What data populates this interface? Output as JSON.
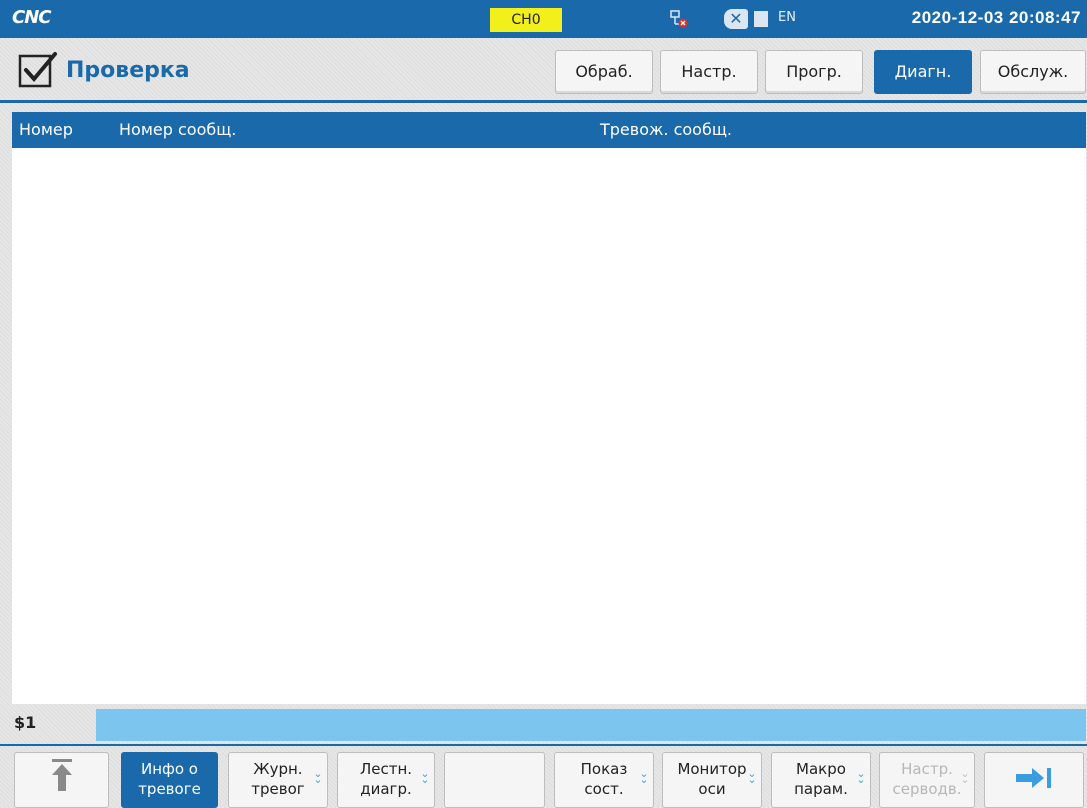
{
  "topbar": {
    "logo": "CNC",
    "channel": "CH0",
    "lang": "EN",
    "datetime": "2020-12-03 20:08:47",
    "colors": {
      "bar": "#1a6aab",
      "channel_bg": "#f2ef1b"
    }
  },
  "page": {
    "title": "Проверка"
  },
  "tabs": [
    {
      "label": "Обраб.",
      "active": false
    },
    {
      "label": "Настр.",
      "active": false
    },
    {
      "label": "Прогр.",
      "active": false
    },
    {
      "label": "Диагн.",
      "active": true
    },
    {
      "label": "Обслуж.",
      "active": false
    }
  ],
  "table": {
    "headers": [
      "Номер",
      "Номер сообщ.",
      "Тревож. сообщ."
    ],
    "rows": []
  },
  "status": {
    "prefix": "$1",
    "command": ""
  },
  "softkeys": [
    {
      "line1": "",
      "line2": "",
      "icon": "arrow-up-top-icon",
      "active": false,
      "disabled": false,
      "menu": false
    },
    {
      "line1": "Инфо о",
      "line2": "тревоге",
      "active": true,
      "disabled": false,
      "menu": false
    },
    {
      "line1": "Журн.",
      "line2": "тревог",
      "active": false,
      "disabled": false,
      "menu": true
    },
    {
      "line1": "Лестн.",
      "line2": "диагр.",
      "active": false,
      "disabled": false,
      "menu": true
    },
    {
      "line1": "",
      "line2": "",
      "active": false,
      "disabled": false,
      "menu": false
    },
    {
      "line1": "Показ",
      "line2": "сост.",
      "active": false,
      "disabled": false,
      "menu": true
    },
    {
      "line1": "Монитор",
      "line2": "оси",
      "active": false,
      "disabled": false,
      "menu": true
    },
    {
      "line1": "Макро",
      "line2": "парам.",
      "active": false,
      "disabled": false,
      "menu": true
    },
    {
      "line1": "Настр.",
      "line2": "серводв.",
      "active": false,
      "disabled": true,
      "menu": true
    },
    {
      "line1": "",
      "line2": "",
      "icon": "arrow-right-end-icon",
      "active": false,
      "disabled": false,
      "menu": false
    }
  ]
}
